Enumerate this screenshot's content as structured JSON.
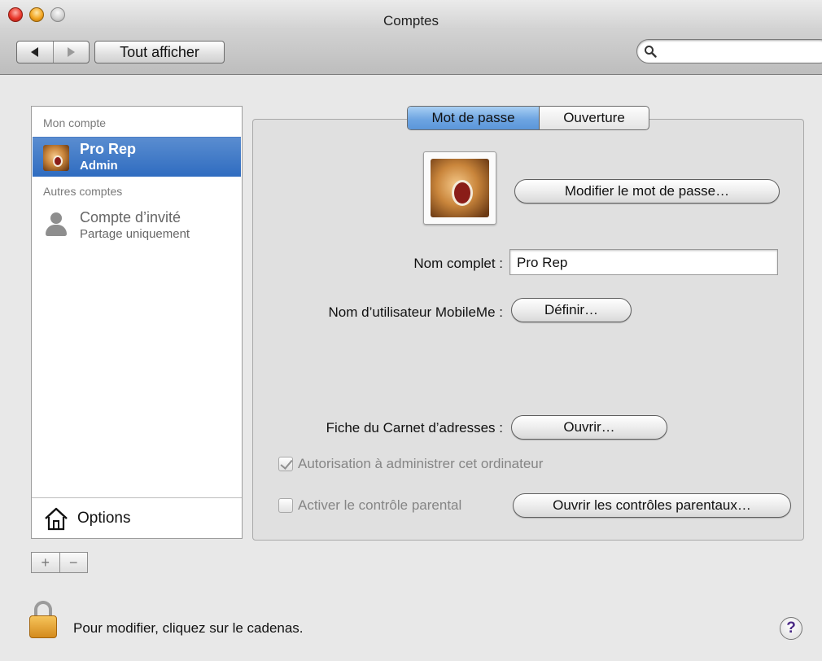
{
  "window": {
    "title": "Comptes"
  },
  "toolbar": {
    "show_all_label": "Tout afficher",
    "search": {
      "value": "",
      "placeholder": ""
    }
  },
  "sidebar": {
    "my_account_header": "Mon compte",
    "selected_account": {
      "name": "Pro Rep",
      "role": "Admin"
    },
    "other_accounts_header": "Autres comptes",
    "guest_account": {
      "name": "Compte d’invité",
      "subtitle": "Partage uniquement"
    },
    "options_label": "Options",
    "add_symbol": "+",
    "remove_symbol": "−"
  },
  "tabs": [
    {
      "label": "Mot de passe",
      "active": true
    },
    {
      "label": "Ouverture",
      "active": false
    }
  ],
  "main": {
    "change_password_button": "Modifier le mot de passe…",
    "full_name_label": "Nom complet :",
    "full_name_value": "Pro Rep",
    "mobileme_label": "Nom d’utilisateur MobileMe :",
    "mobileme_button": "Définir…",
    "address_book_label": "Fiche du Carnet d’adresses :",
    "address_book_button": "Ouvrir…",
    "admin_checkbox_label": "Autorisation à administrer cet ordinateur",
    "admin_checkbox_checked": true,
    "parental_checkbox_label": "Activer le contrôle parental",
    "parental_checkbox_checked": false,
    "parental_button": "Ouvrir les contrôles parentaux…"
  },
  "footer": {
    "lock_text": "Pour modifier, cliquez sur le cadenas.",
    "help_symbol": "?"
  },
  "colors": {
    "selection_blue": "#3a74c4",
    "tab_active_blue": "#6ea5e2",
    "lock_gold": "#e0a030"
  }
}
